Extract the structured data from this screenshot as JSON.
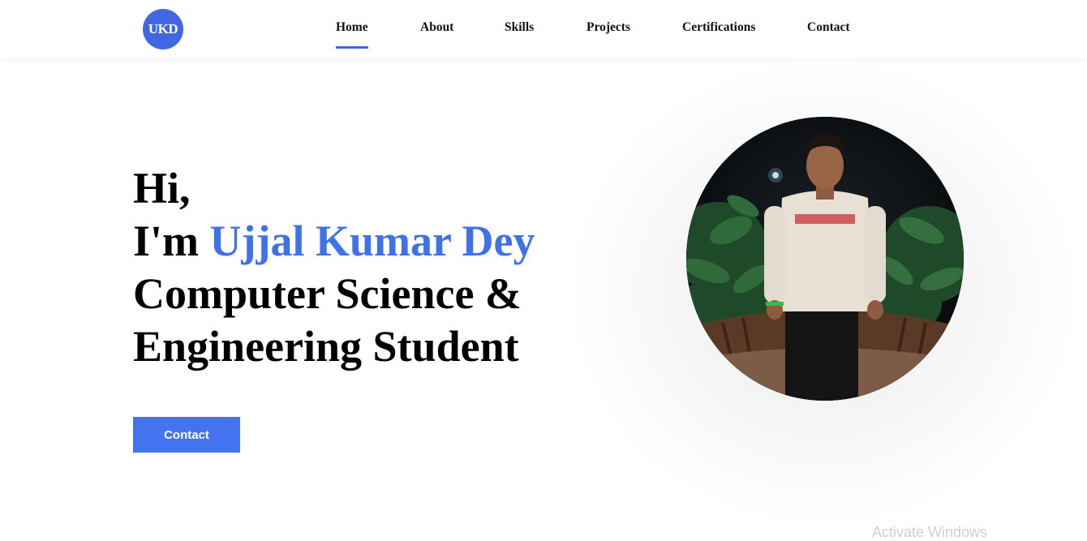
{
  "nav": {
    "logo_text": "UKD",
    "items": [
      {
        "label": "Home",
        "active": true
      },
      {
        "label": "About",
        "active": false
      },
      {
        "label": "Skills",
        "active": false
      },
      {
        "label": "Projects",
        "active": false
      },
      {
        "label": "Certifications",
        "active": false
      },
      {
        "label": "Contact",
        "active": false
      }
    ]
  },
  "hero": {
    "greeting": "Hi,",
    "intro_prefix": "I'm",
    "name": "Ujjal Kumar Dey",
    "role_line1": "Computer Science &",
    "role_line2": "Engineering Student",
    "contact_button": "Contact"
  },
  "portrait": {
    "icon": "profile-photo",
    "shirt_text": "FREEDOM"
  },
  "watermark": {
    "text": "Activate Windows"
  },
  "colors": {
    "accent": "#3f72e8",
    "button": "#4373f0",
    "logo": "#3f67df"
  }
}
